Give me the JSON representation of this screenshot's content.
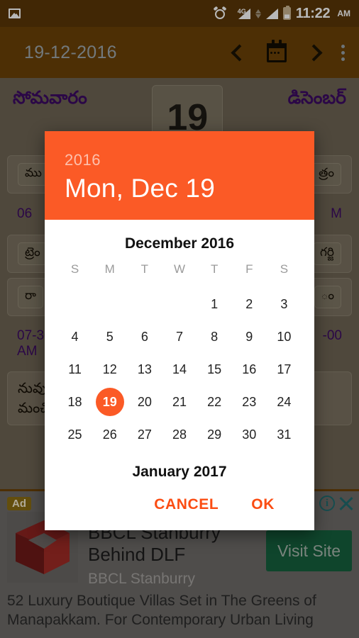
{
  "status_bar": {
    "photo_icon": "image-icon",
    "alarm_icon": "alarm-icon",
    "network_label": "4G",
    "time": "11:22",
    "ampm": "AM"
  },
  "toolbar": {
    "title": "19-12-2016",
    "prev_icon": "chevron-left-icon",
    "calendar_icon": "calendar-icon",
    "next_icon": "chevron-right-icon",
    "overflow_icon": "more-vertical-icon"
  },
  "app": {
    "weekday_te": "సోమవారం",
    "day_number": "19",
    "month_te": "డిసెంబర్",
    "rows": [
      {
        "chip_left": "ము",
        "chip_right": "త్రం"
      },
      {
        "time_left": "06",
        "time_right": "M"
      },
      {
        "chip_left": "ట్రెం",
        "chip_right": "గర్జి"
      },
      {
        "chip_left": "రా",
        "chip_right": "ం"
      },
      {
        "time_left": "07-30 A",
        "time_left2": "AM",
        "time_right": "-00"
      },
      {
        "tel_line1": "నువ్వు",
        "tel_line2": "మంచి"
      }
    ]
  },
  "ad": {
    "badge": "Ad",
    "title_line1": "BBCL Stanburry",
    "title_line2": "Behind DLF",
    "advertiser": "BBCL Stanburry",
    "cta": "Visit Site",
    "description": "52 Luxury Boutique Villas Set in The Greens of Manapakkam. For Contemporary Urban Living",
    "info_icon": "info-icon",
    "close_icon": "close-icon",
    "logo_icon": "bbcl-s-logo-icon"
  },
  "dialog": {
    "header_year": "2016",
    "header_date": "Mon, Dec 19",
    "month_title": "December 2016",
    "next_month_title": "January 2017",
    "weekdays": [
      "S",
      "M",
      "T",
      "W",
      "T",
      "F",
      "S"
    ],
    "weeks": [
      [
        "",
        "",
        "",
        "",
        "1",
        "2",
        "3"
      ],
      [
        "4",
        "5",
        "6",
        "7",
        "8",
        "9",
        "10"
      ],
      [
        "11",
        "12",
        "13",
        "14",
        "15",
        "16",
        "17"
      ],
      [
        "18",
        "19",
        "20",
        "21",
        "22",
        "23",
        "24"
      ],
      [
        "25",
        "26",
        "27",
        "28",
        "29",
        "30",
        "31"
      ]
    ],
    "selected_day": "19",
    "cancel_label": "CANCEL",
    "ok_label": "OK",
    "accent_color": "#fb5a26"
  }
}
